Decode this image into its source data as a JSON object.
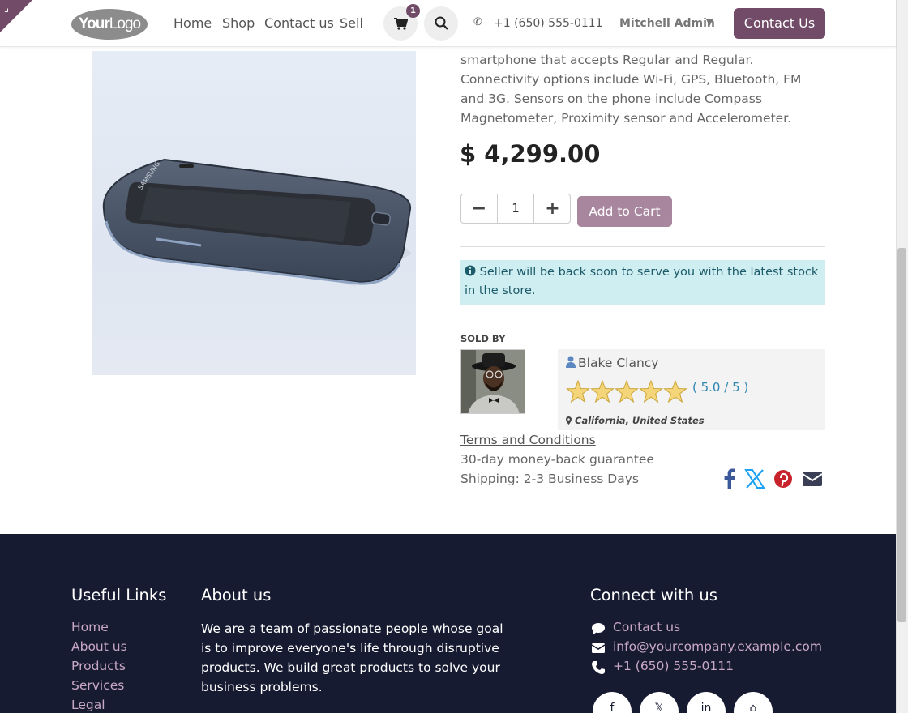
{
  "header": {
    "logo_text_bold": "Your",
    "logo_text_light": "Logo",
    "nav": [
      "Home",
      "Shop",
      "Contact us",
      "Sell"
    ],
    "cart_count": "1",
    "phone": "+1 (650) 555-0111",
    "user": "Mitchell Admin",
    "contact_button": "Contact Us"
  },
  "product": {
    "description": "smartphone that accepts Regular and Regular. Connectivity options include Wi-Fi, GPS, Bluetooth, FM and 3G. Sensors on the phone include Compass Magnetometer, Proximity sensor and Accelerometer.",
    "price": "$ 4,299.00",
    "quantity": "1",
    "add_to_cart": "Add to Cart",
    "stock_alert": "Seller will be back soon to serve you with the latest stock in the store.",
    "phone_brand_text": "SAMSUNG"
  },
  "seller": {
    "sold_by_label": "SOLD BY",
    "name": "Blake Clancy",
    "rating": 5.0,
    "rating_text": "( 5.0 / 5 )",
    "location": "California, United States"
  },
  "policies": {
    "terms": "Terms and Conditions",
    "guarantee": "30-day money-back guarantee",
    "shipping": "Shipping: 2-3 Business Days"
  },
  "share_icons": [
    "facebook-icon",
    "x-twitter-icon",
    "pinterest-icon",
    "envelope-icon"
  ],
  "footer": {
    "useful_links_title": "Useful Links",
    "useful_links": [
      "Home",
      "About us",
      "Products",
      "Services",
      "Legal"
    ],
    "about_title": "About us",
    "about_text": "We are a team of passionate people whose goal is to improve everyone's life through disruptive products. We build great products to solve your business problems.",
    "connect_title": "Connect with us",
    "contact_link": "Contact us",
    "email": "info@yourcompany.example.com",
    "phone": "+1 (650) 555-0111",
    "social_icons": [
      "facebook-icon",
      "x-twitter-icon",
      "linkedin-icon",
      "home-icon"
    ]
  },
  "colors": {
    "brand": "#714B67",
    "footer_bg": "#171b31",
    "alert_bg": "#cfeef1",
    "footer_link": "#c8a7c7"
  }
}
